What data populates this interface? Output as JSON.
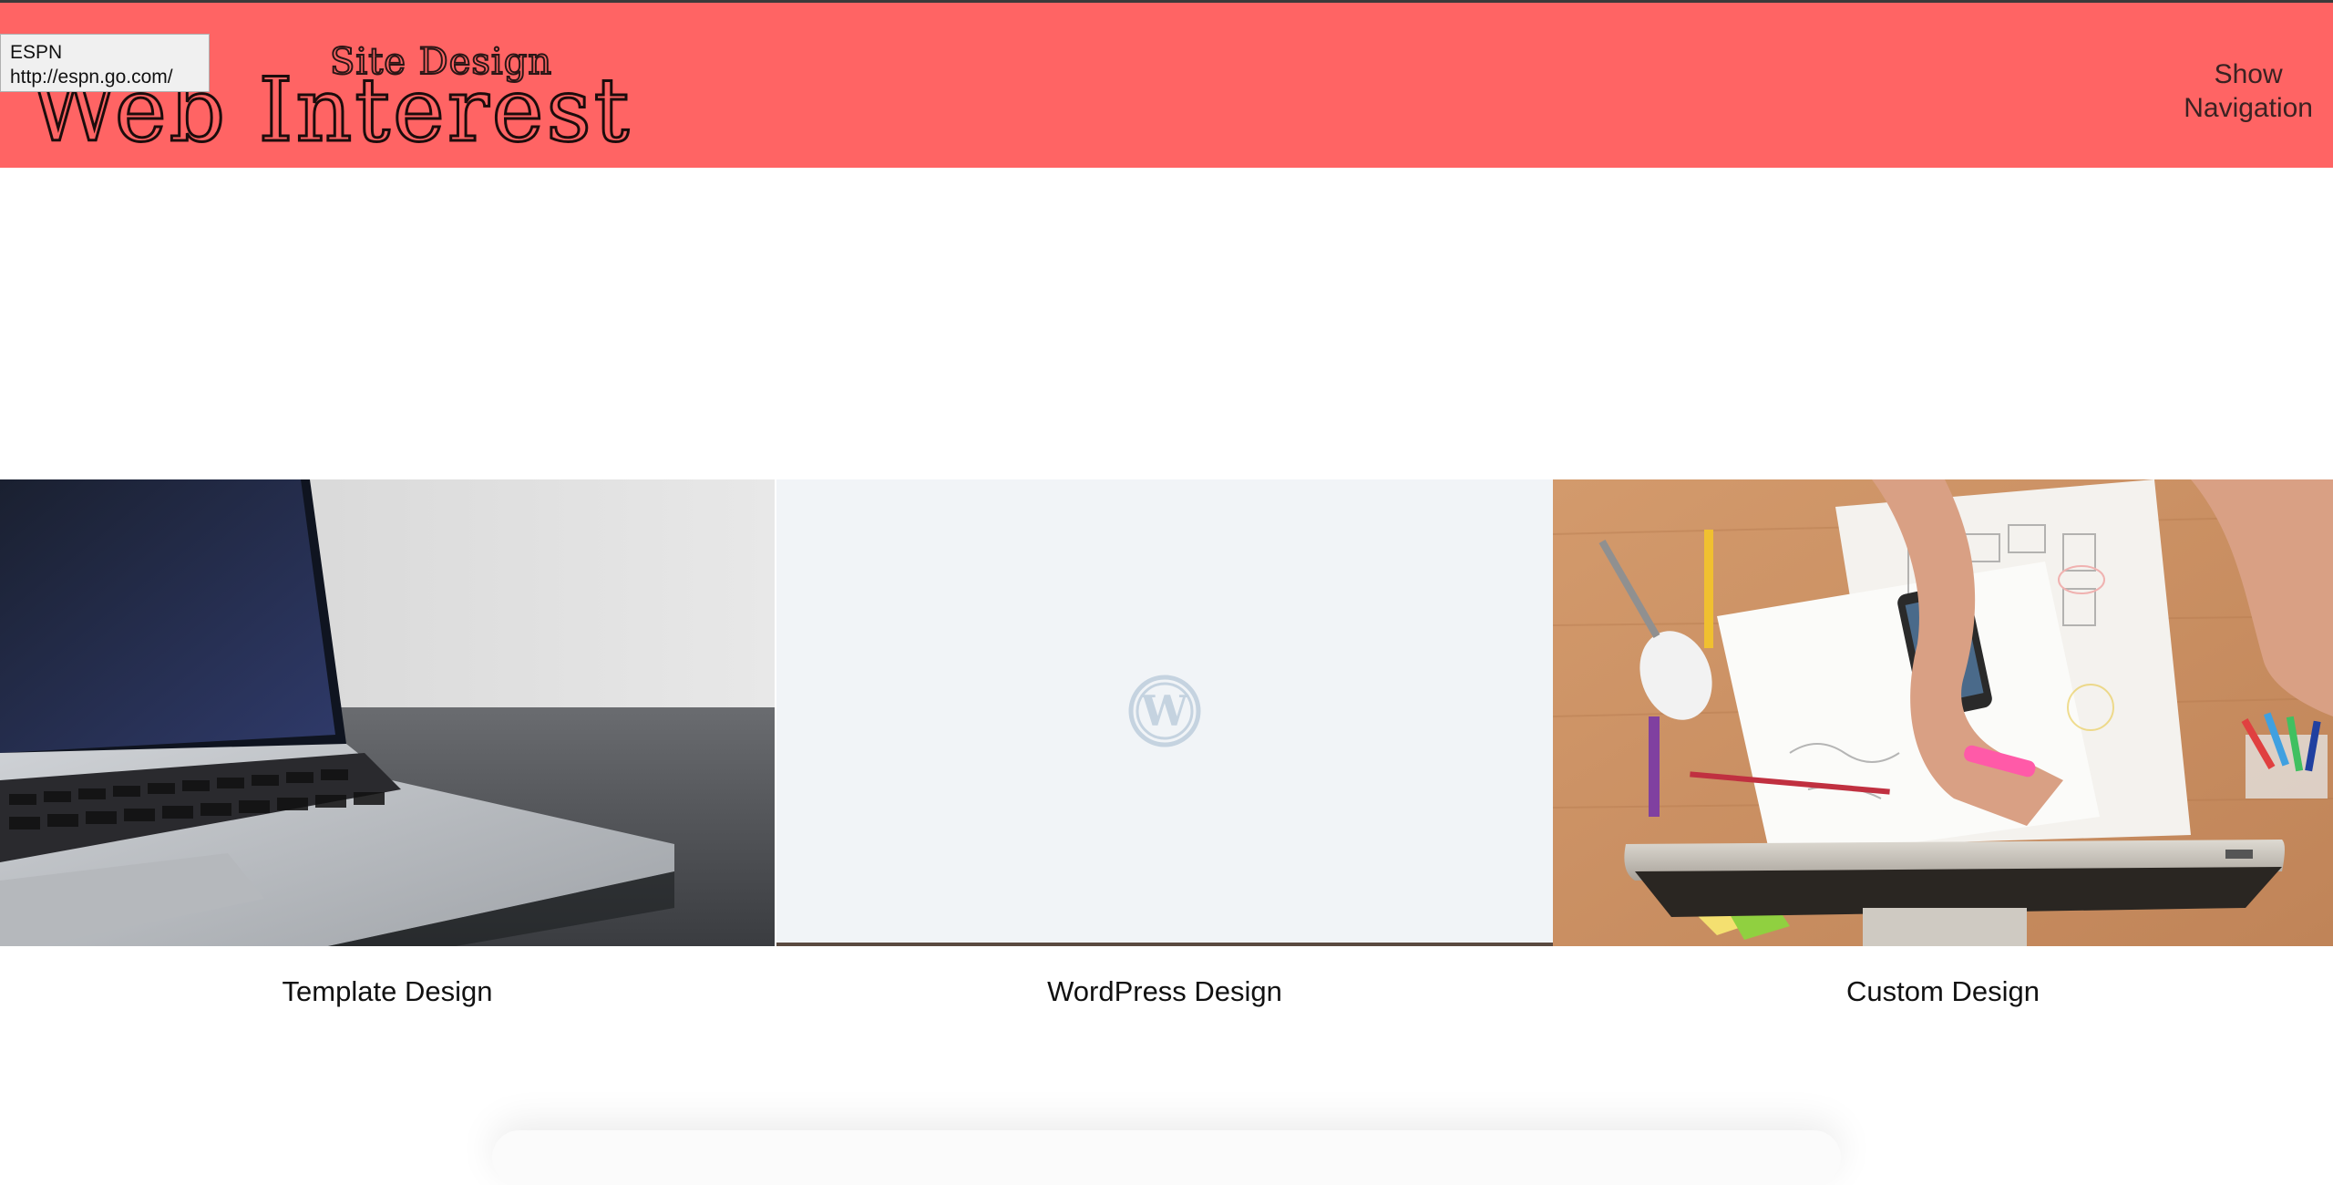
{
  "header": {
    "logo_sub": "Site Design",
    "logo_main": "Web Interest",
    "nav_toggle_line1": "Show",
    "nav_toggle_line2": "Navigation",
    "background_color": "#ff6464"
  },
  "tooltip": {
    "title": "ESPN",
    "url": "http://espn.go.com/"
  },
  "services": [
    {
      "label": "Template Design",
      "image": "laptop-photo"
    },
    {
      "label": "WordPress Design",
      "image": "wordpress-placeholder"
    },
    {
      "label": "Custom Design",
      "image": "desk-workspace-photo"
    }
  ]
}
